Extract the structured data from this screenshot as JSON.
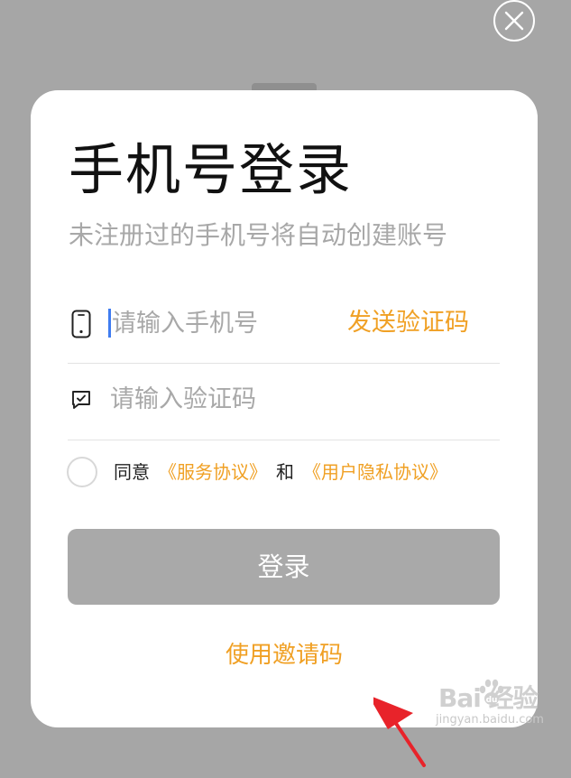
{
  "login": {
    "title": "手机号登录",
    "subtitle": "未注册过的手机号将自动创建账号",
    "phone_placeholder": "请输入手机号",
    "send_code_label": "发送验证码",
    "code_placeholder": "请输入验证码",
    "agree_prefix": "同意",
    "service_agreement_link": "《服务协议》",
    "and_text": "和",
    "privacy_agreement_link": "《用户隐私协议》",
    "login_button_label": "登录",
    "invite_code_link": "使用邀请码"
  },
  "watermark": {
    "brand": "Bai  经验",
    "url": "jingyan.baidu.com"
  },
  "icons": {
    "close": "close-icon",
    "phone": "phone-icon",
    "sms": "message-icon",
    "arrow": "red-arrow-annotation"
  },
  "colors": {
    "accent": "#f0a024",
    "button_disabled": "#a9a9a9",
    "overlay": "#a6a6a6",
    "arrow": "#e8232a"
  }
}
